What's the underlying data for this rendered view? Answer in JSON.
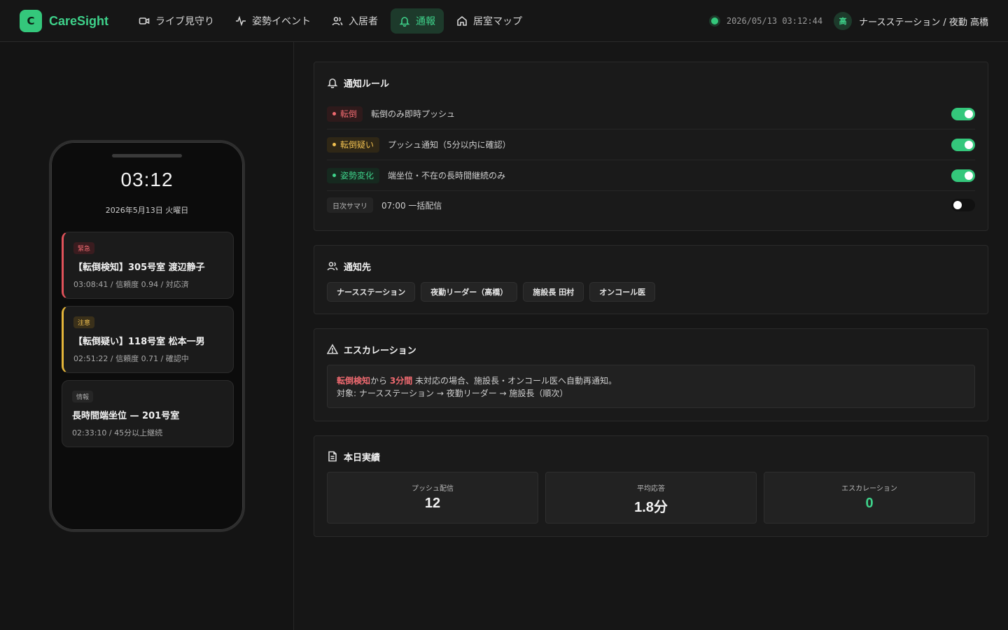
{
  "app": {
    "logo_letter": "C",
    "name": "CareSight"
  },
  "nav": {
    "items": [
      {
        "label": "ライブ見守り",
        "icon": "video-icon"
      },
      {
        "label": "姿勢イベント",
        "icon": "activity-icon"
      },
      {
        "label": "入居者",
        "icon": "users-icon"
      },
      {
        "label": "通報",
        "icon": "bell-icon",
        "active": true
      },
      {
        "label": "居室マップ",
        "icon": "home-icon"
      }
    ]
  },
  "status": {
    "datetime": "2026/05/13 03:12:44",
    "user_initial": "高",
    "user_label": "ナースステーション / 夜勤 高橋"
  },
  "phone": {
    "time": "03:12",
    "date": "2026年5月13日 火曜日",
    "notifications": [
      {
        "level": "緊急",
        "title": "【転倒検知】305号室 渡辺静子",
        "meta": "03:08:41 / 信頼度 0.94 / 対応済"
      },
      {
        "level": "注意",
        "title": "【転倒疑い】118号室 松本一男",
        "meta": "02:51:22 / 信頼度 0.71 / 確認中"
      },
      {
        "level": "情報",
        "title": "長時間端坐位 — 201号室",
        "meta": "02:33:10 / 45分以上継続"
      }
    ]
  },
  "rules": {
    "title": "通知ルール",
    "items": [
      {
        "tag": "転倒",
        "desc": "転倒のみ即時プッシュ",
        "enabled": true
      },
      {
        "tag": "転倒疑い",
        "desc": "プッシュ通知（5分以内に確認）",
        "enabled": true
      },
      {
        "tag": "姿勢変化",
        "desc": "端坐位・不在の長時間継続のみ",
        "enabled": true
      },
      {
        "tag": "日次サマリ",
        "desc": "07:00 一括配信",
        "enabled": false
      }
    ]
  },
  "recipients": {
    "title": "通知先",
    "items": [
      "ナースステーション",
      "夜勤リーダー（高橋）",
      "施設長 田村",
      "オンコール医"
    ]
  },
  "escalation": {
    "title": "エスカレーション",
    "trigger": "転倒検知",
    "from": "から",
    "minutes": "3分間",
    "rest": "未対応の場合、施設長・オンコール医へ自動再通知。",
    "targets": "対象: ナースステーション → 夜勤リーダー → 施設長（順次）"
  },
  "today": {
    "title": "本日実績",
    "stats": [
      {
        "label": "プッシュ配信",
        "value": "12"
      },
      {
        "label": "平均応答",
        "value": "1.8分"
      },
      {
        "label": "エスカレーション",
        "value": "0"
      }
    ]
  },
  "colors": {
    "accent": "#34c77b",
    "urgent": "#f06a70",
    "warn": "#f0c050"
  }
}
